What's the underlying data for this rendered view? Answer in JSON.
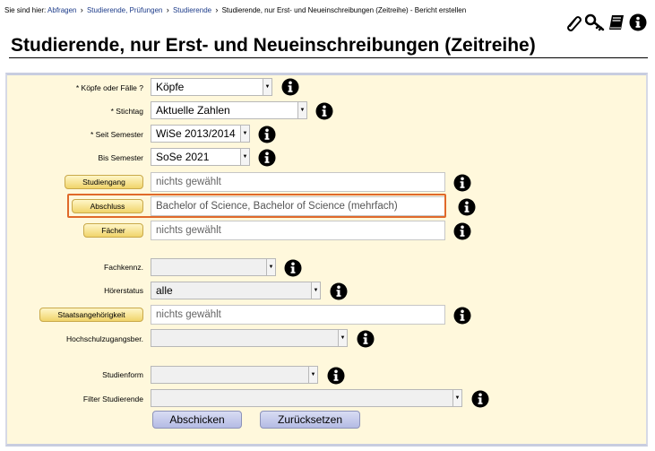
{
  "breadcrumb": {
    "prefix": "Sie sind hier:",
    "items": [
      "Abfragen",
      "Studierende, Prüfungen",
      "Studierende"
    ],
    "current": "Studierende, nur Erst- und Neueinschreibungen (Zeitreihe) - Bericht erstellen"
  },
  "toolbar": {
    "icons": [
      "paperclip-icon",
      "key-icon",
      "book-icon",
      "info-icon"
    ]
  },
  "page_title": "Studierende, nur Erst- und Neueinschreibungen (Zeitreihe)",
  "form": {
    "koepfe": {
      "label": "* Köpfe oder Fälle ?",
      "value": "Köpfe"
    },
    "stichtag": {
      "label": "* Stichtag",
      "value": "Aktuelle Zahlen"
    },
    "seit_semester": {
      "label": "* Seit Semester",
      "value": "WiSe 2013/2014"
    },
    "bis_semester": {
      "label": "Bis Semester",
      "value": "SoSe 2021"
    },
    "studiengang": {
      "button": "Studiengang",
      "value": "nichts gewählt"
    },
    "abschluss": {
      "button": "Abschluss",
      "value": "Bachelor of Science, Bachelor of Science (mehrfach)"
    },
    "faecher": {
      "button": "Fächer",
      "value": "nichts gewählt"
    },
    "fachkennz": {
      "label": "Fachkennz.",
      "value": ""
    },
    "hoererstatus": {
      "label": "Hörerstatus",
      "value": "alle"
    },
    "staatsangehoerigkeit": {
      "button": "Staatsangehörigkeit",
      "value": "nichts gewählt"
    },
    "hochschulzugangsber": {
      "label": "Hochschulzugangsber.",
      "value": ""
    },
    "studienform": {
      "label": "Studienform",
      "value": ""
    },
    "filter_studierende": {
      "label": "Filter Studierende",
      "value": ""
    }
  },
  "buttons": {
    "submit": "Abschicken",
    "reset": "Zurücksetzen"
  },
  "colors": {
    "panel_bg": "#fff8dc",
    "highlight": "#e0692a",
    "link": "#1d3c8a"
  }
}
